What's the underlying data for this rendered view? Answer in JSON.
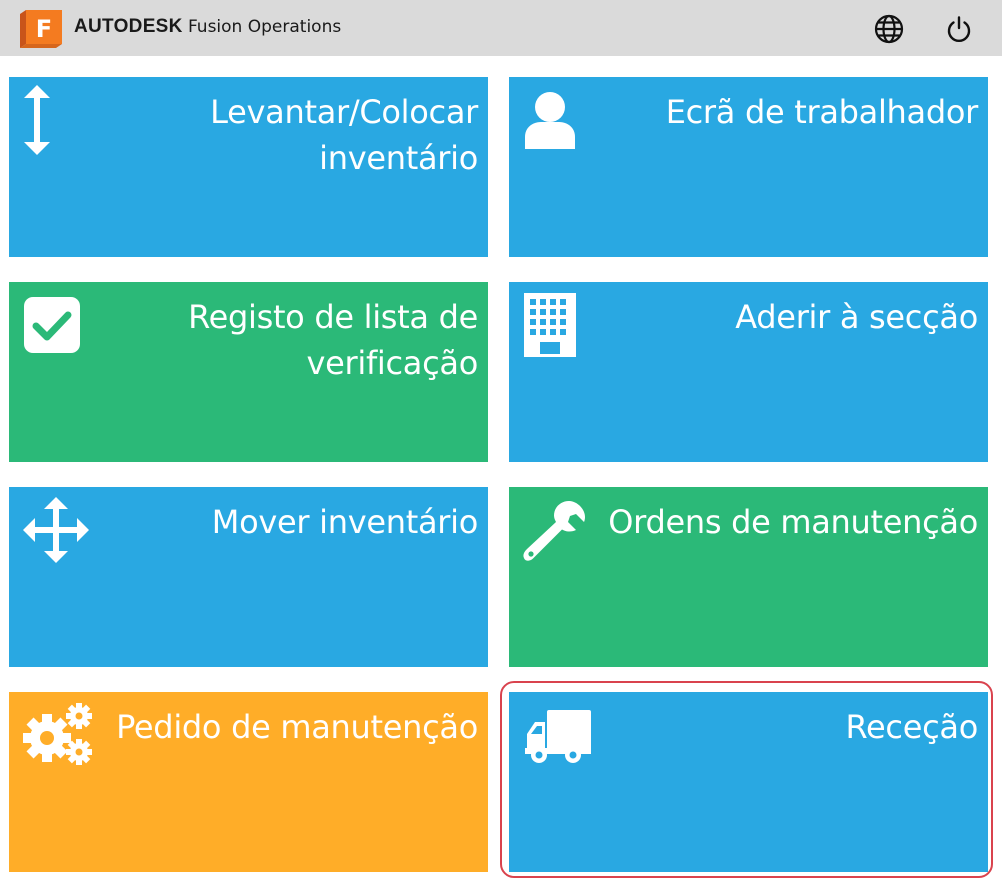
{
  "header": {
    "brand_bold": "AUTODESK",
    "brand_product": "Fusion Operations",
    "logo_letter": "F",
    "icons": {
      "language": "globe-icon",
      "logout": "power-icon"
    }
  },
  "tiles": [
    {
      "label": "Levantar/Colocar inventário",
      "icon": "vertical-arrows-icon",
      "color": "#29a8e2"
    },
    {
      "label": "Ecrã de trabalhador",
      "icon": "user-icon",
      "color": "#29a8e2"
    },
    {
      "label": "Registo de lista de verificação",
      "icon": "checkbox-icon",
      "color": "#2bb978"
    },
    {
      "label": "Aderir à secção",
      "icon": "building-icon",
      "color": "#29a8e2"
    },
    {
      "label": "Mover inventário",
      "icon": "move-arrows-icon",
      "color": "#29a8e2"
    },
    {
      "label": "Ordens de manutenção",
      "icon": "wrench-icon",
      "color": "#2bb978"
    },
    {
      "label": "Pedido de manutenção",
      "icon": "gears-icon",
      "color": "#ffad28"
    },
    {
      "label": "Receção",
      "icon": "truck-icon",
      "color": "#29a8e2"
    }
  ],
  "colors": {
    "header_bg": "#dadada",
    "blue": "#29a8e2",
    "green": "#2bb978",
    "orange": "#ffad28",
    "highlight": "#d9434e",
    "logo_orange": "#f47b20"
  }
}
